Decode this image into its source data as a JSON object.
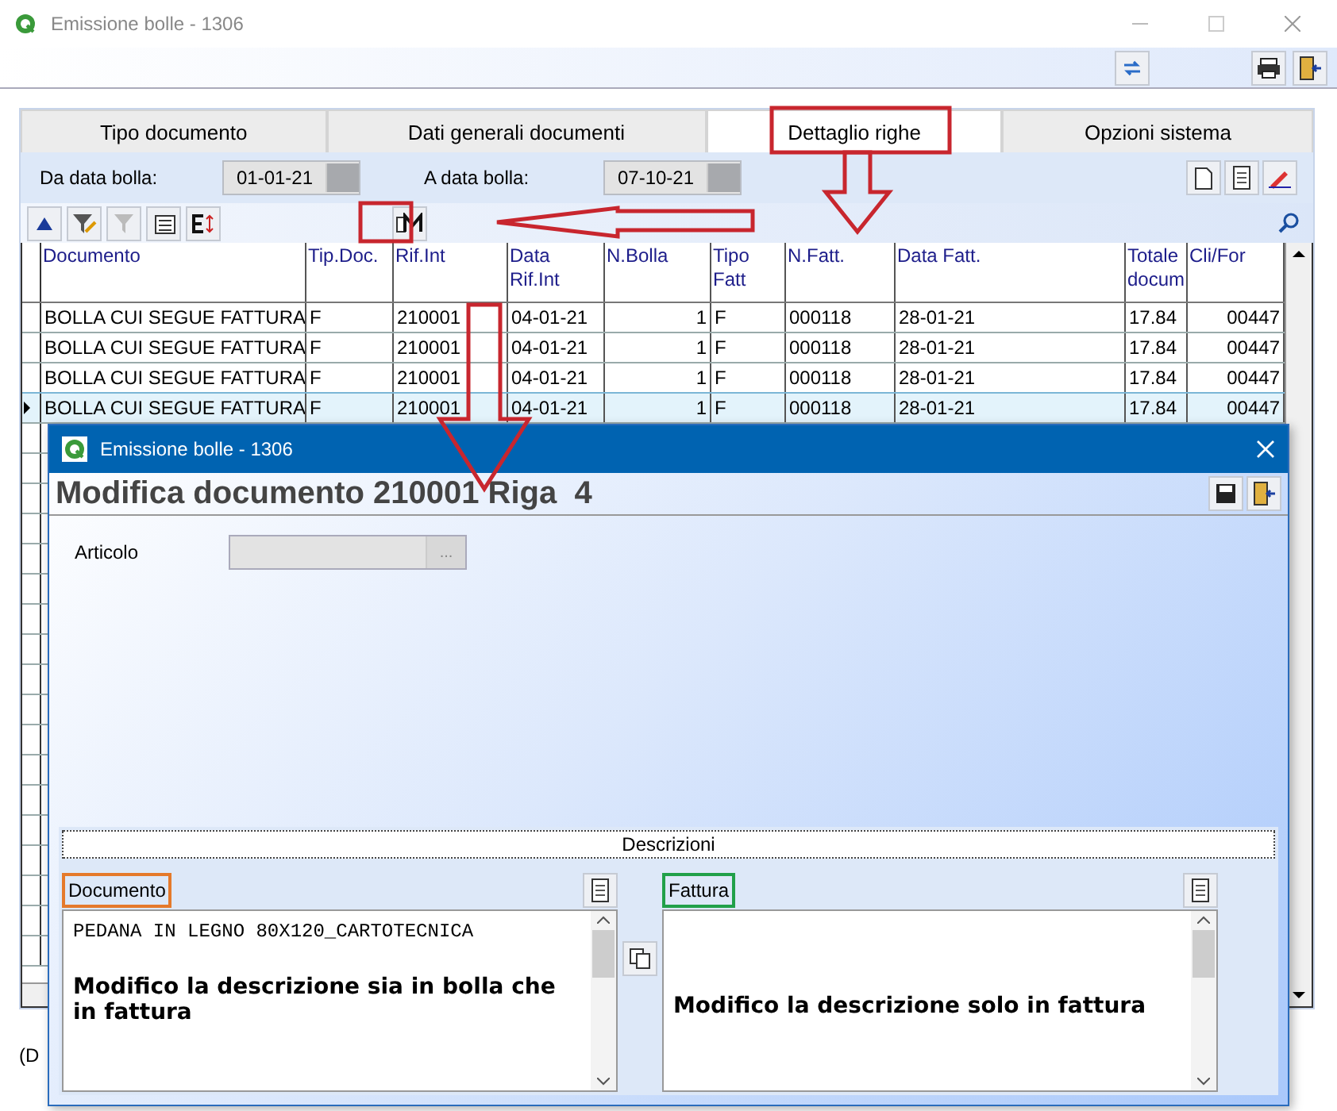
{
  "window": {
    "title": "Emissione bolle - 1306"
  },
  "tabs": [
    {
      "label": "Tipo documento",
      "selected": false
    },
    {
      "label": "Dati generali documenti",
      "selected": false
    },
    {
      "label": "Dettaglio righe",
      "selected": true
    },
    {
      "label": "Opzioni sistema",
      "selected": false
    }
  ],
  "filters": [
    {
      "label": "Da data bolla:",
      "value": "01-01-21"
    },
    {
      "label": "A data bolla:",
      "value": "07-10-21"
    }
  ],
  "grid": {
    "columns": [
      "Documento",
      "Tip.Doc.",
      "Rif.Int",
      "Data Rif.Int",
      "N.Bolla",
      "Tipo Fatt",
      "N.Fatt.",
      "Data Fatt.",
      "Totale docum",
      "Cli/For"
    ],
    "rows": [
      {
        "cells": [
          "BOLLA CUI SEGUE FATTURA",
          "F",
          "210001",
          "04-01-21",
          "1",
          "F",
          "000118",
          "28-01-21",
          "17.84",
          "00447"
        ],
        "selected": false
      },
      {
        "cells": [
          "BOLLA CUI SEGUE FATTURA",
          "F",
          "210001",
          "04-01-21",
          "1",
          "F",
          "000118",
          "28-01-21",
          "17.84",
          "00447"
        ],
        "selected": false
      },
      {
        "cells": [
          "BOLLA CUI SEGUE FATTURA",
          "F",
          "210001",
          "04-01-21",
          "1",
          "F",
          "000118",
          "28-01-21",
          "17.84",
          "00447"
        ],
        "selected": false
      },
      {
        "cells": [
          "BOLLA CUI SEGUE FATTURA",
          "F",
          "210001",
          "04-01-21",
          "1",
          "F",
          "000118",
          "28-01-21",
          "17.84",
          "00447"
        ],
        "selected": true
      }
    ]
  },
  "status_text": "(D",
  "dialog": {
    "title": "Emissione bolle - 1306",
    "heading": "Modifica documento 210001 Riga  4",
    "field_label": "Articolo",
    "field_button": "...",
    "section_title": "Descrizioni",
    "panels": [
      {
        "label": "Documento",
        "color": "#e5792b",
        "code_line": "PEDANA IN LEGNO 80X120_CARTOTECNICA",
        "note": "Modifico la descrizione sia in bolla che in fattura"
      },
      {
        "label": "Fattura",
        "color": "#21a049",
        "note": "Modifico la descrizione solo in fattura"
      }
    ]
  }
}
